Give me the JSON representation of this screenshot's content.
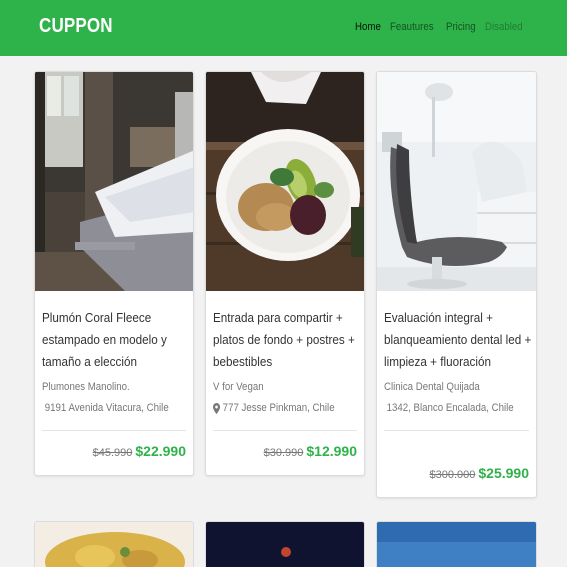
{
  "navbar": {
    "brand": "CUPPON",
    "links": [
      {
        "label": "Home",
        "state": "active"
      },
      {
        "label": "Feautures",
        "state": "normal"
      },
      {
        "label": "Pricing",
        "state": "normal"
      },
      {
        "label": "Disabled",
        "state": "disabled"
      }
    ]
  },
  "deals": [
    {
      "title": "Plumón Coral Fleece estampado en modelo y tamaño a elección",
      "merchant": "Plumones Manolino.",
      "address": "9191 Avenida Vitacura, Chile",
      "old_price": "$45.990",
      "price": "$22.990",
      "image": "bedroom-photo"
    },
    {
      "title": "Entrada para compartir + platos de fondo + postres + bebestibles",
      "merchant": "V for Vegan",
      "address": "777 Jesse Pinkman, Chile",
      "old_price": "$30.990",
      "price": "$12.990",
      "image": "salad-plate-photo"
    },
    {
      "title": "Evaluación integral + blanqueamiento dental led + limpieza + fluoración",
      "merchant": "Clinica Dental Quijada",
      "address": "1342, Blanco Encalada, Chile",
      "old_price": "$300.000",
      "price": "$25.990",
      "image": "dental-chair-photo"
    }
  ],
  "colors": {
    "brand_green": "#2eb24a",
    "price_green": "#2eb24a"
  }
}
